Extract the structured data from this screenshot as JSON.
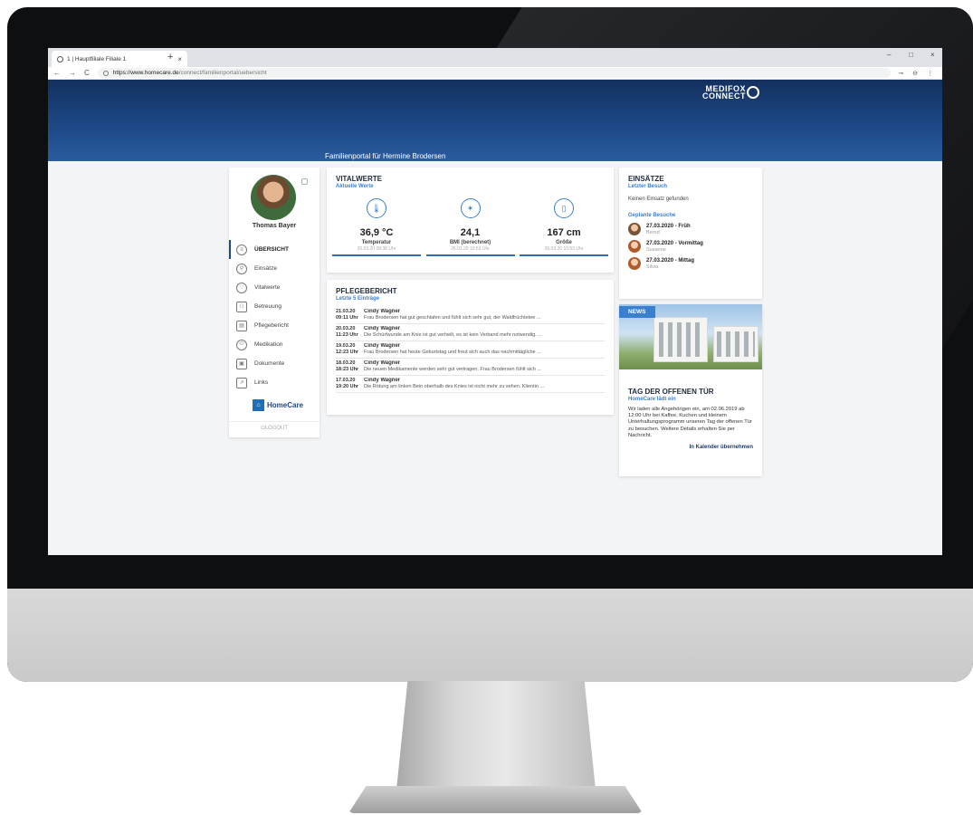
{
  "browser": {
    "tab_title": "1 | Hauptfiliale Filiale 1",
    "tab_close": "×",
    "new_tab": "+",
    "url_host": "https://www.homecare.de",
    "url_path": "/connect/familienportal/uebersicht",
    "nav_back": "←",
    "nav_forward": "→",
    "nav_reload": "C",
    "minimize": "–",
    "maximize": "□",
    "close": "×",
    "addr_icons": "⊸ ⊖ ⋮"
  },
  "header": {
    "logo_line1": "MEDIFOX",
    "logo_line2": "CONNECT",
    "portal_title": "Familienportal für Hermine Brodersen"
  },
  "sidebar": {
    "user_name": "Thomas Bayer",
    "items": [
      {
        "label": "ÜBERSICHT",
        "icon": "overview-icon",
        "glyph": "≡"
      },
      {
        "label": "Einsätze",
        "icon": "assignments-icon",
        "glyph": "⚲"
      },
      {
        "label": "Vitalwerte",
        "icon": "heart-icon",
        "glyph": "♡"
      },
      {
        "label": "Betreuung",
        "icon": "care-icon",
        "glyph": "⚇"
      },
      {
        "label": "Pflegebericht",
        "icon": "report-icon",
        "glyph": "▤"
      },
      {
        "label": "Medikation",
        "icon": "pill-icon",
        "glyph": "⬭"
      },
      {
        "label": "Dokumente",
        "icon": "document-icon",
        "glyph": "▣"
      },
      {
        "label": "Links",
        "icon": "link-icon",
        "glyph": "↗"
      }
    ],
    "brand_name": "HomeCare",
    "logout": "LOGOUT"
  },
  "vitals": {
    "title": "VITALWERTE",
    "subtitle": "Aktuelle Werte",
    "items": [
      {
        "value": "36,9 °C",
        "label": "Temperatur",
        "time": "26.03.20   08:38 Uhr",
        "glyph": "🌡"
      },
      {
        "value": "24,1",
        "label": "BMI (berechnet)",
        "time": "26.03.20   10:53 Uhr",
        "glyph": "✶"
      },
      {
        "value": "167 cm",
        "label": "Größe",
        "time": "26.03.20   10:53 Uhr",
        "glyph": "▯"
      }
    ]
  },
  "care_report": {
    "title": "PFLEGEBERICHT",
    "subtitle": "Letzte 5 Einträge",
    "entries": [
      {
        "date": "21.03.20",
        "time": "09:11 Uhr",
        "author": "Cindy Wagner",
        "text": "Frau Brodersen hat gut geschlafen und fühlt sich sehr gut, der Waldfrüchtetee ..."
      },
      {
        "date": "20.03.20",
        "time": "11:23 Uhr",
        "author": "Cindy Wagner",
        "text": "Die Schürfwunde am Knie ist gut verheilt, es ist kein Verband mehr notwendig. ..."
      },
      {
        "date": "19.03.20",
        "time": "12:23 Uhr",
        "author": "Cindy Wagner",
        "text": "Frau Brodersen hat heute Geburtstag und freut sich auch das nachmittägliche ..."
      },
      {
        "date": "18.03.20",
        "time": "18:23 Uhr",
        "author": "Cindy Wagner",
        "text": "Die neuen Medikamente werden sehr gut vertragen. Frau Brodersen fühlt sich ..."
      },
      {
        "date": "17.03.20",
        "time": "19:20 Uhr",
        "author": "Cindy Wagner",
        "text": "Die Rötung am linken Bein oberhalb des Knies ist nicht mehr zu sehen. Klientin ..."
      }
    ]
  },
  "assignments": {
    "title": "EINSÄTZE",
    "subtitle": "Letzter Besuch",
    "none_found": "Keinen Einsatz gefunden",
    "planned_title": "Geplante Besuche",
    "visits": [
      {
        "when": "27.03.2020 - Früh",
        "name": "Bernd"
      },
      {
        "when": "27.03.2020 - Vormittag",
        "name": "Susanne"
      },
      {
        "when": "27.03.2020 - Mittag",
        "name": "Silvia"
      }
    ]
  },
  "news": {
    "badge": "NEWS",
    "title": "TAG DER OFFENEN TÜR",
    "subtitle": "HomeCare lädt ein",
    "text": "Wir laden alle Angehörigen ein, am 02.06.2019 ab 12:00 Uhr bei Kaffee, Kuchen und kleinem Unterhaltungsprogramm unseren Tag der offenen Tür zu besuchen. Weitere Details erhalten Sie per Nachricht.",
    "link": "In Kalender übernehmen"
  }
}
